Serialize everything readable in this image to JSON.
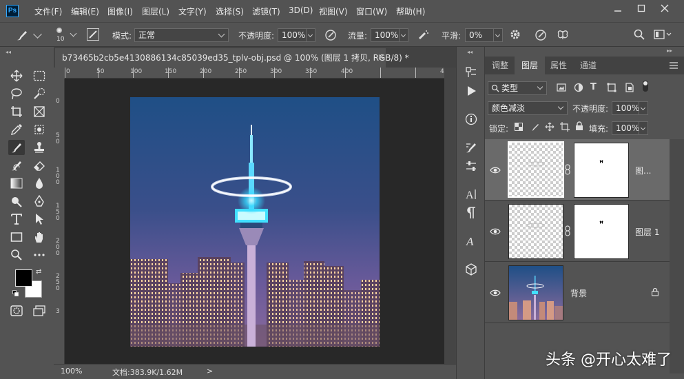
{
  "app": {
    "logo_text": "Ps"
  },
  "menu": [
    "文件(F)",
    "编辑(E)",
    "图像(I)",
    "图层(L)",
    "文字(Y)",
    "选择(S)",
    "滤镜(T)",
    "3D(D)",
    "视图(V)",
    "窗口(W)",
    "帮助(H)"
  ],
  "options": {
    "brush_size": "10",
    "mode_label": "模式:",
    "mode_value": "正常",
    "opacity_label": "不透明度:",
    "opacity_value": "100%",
    "flow_label": "流量:",
    "flow_value": "100%",
    "smooth_label": "平滑:",
    "smooth_value": "0%"
  },
  "document": {
    "tab_title": "b73465b2cb5e4130886134c85039ed35_tplv-obj.psd @ 100% (图层 1 拷贝, RGB/8) *",
    "close_glyph": "×",
    "ruler_h": [
      "0",
      "50",
      "100",
      "150",
      "200",
      "250",
      "300",
      "350",
      "400",
      "4"
    ],
    "ruler_v": [
      "0",
      "5",
      "0",
      "1",
      "0",
      "0",
      "1",
      "5",
      "0",
      "2",
      "0",
      "0",
      "2",
      "5",
      "0",
      "3"
    ],
    "zoom": "100%",
    "doc_info": "文档:383.9K/1.62M",
    "status_arrow": ">"
  },
  "panels": {
    "tabs": [
      "调整",
      "图层",
      "属性",
      "通道"
    ],
    "active_tab": "图层",
    "filter_kind": "类型",
    "blend_mode": "颜色减淡",
    "opacity_label": "不透明度:",
    "opacity_value": "100%",
    "lock_label": "锁定:",
    "fill_label": "填充:",
    "fill_value": "100%",
    "layers": [
      {
        "name": "图...",
        "mask_mark": "ꟸ",
        "selected": true
      },
      {
        "name": "图层 1",
        "mask_mark": "ꟸ",
        "selected": false
      },
      {
        "name": "背景",
        "selected": false
      }
    ]
  },
  "watermark": "头条 @开心太难了",
  "colors": {
    "accent": "#31a8ff",
    "panel_bg": "#535353",
    "canvas_bg": "#282828",
    "selected_row": "#6a6a6a"
  }
}
